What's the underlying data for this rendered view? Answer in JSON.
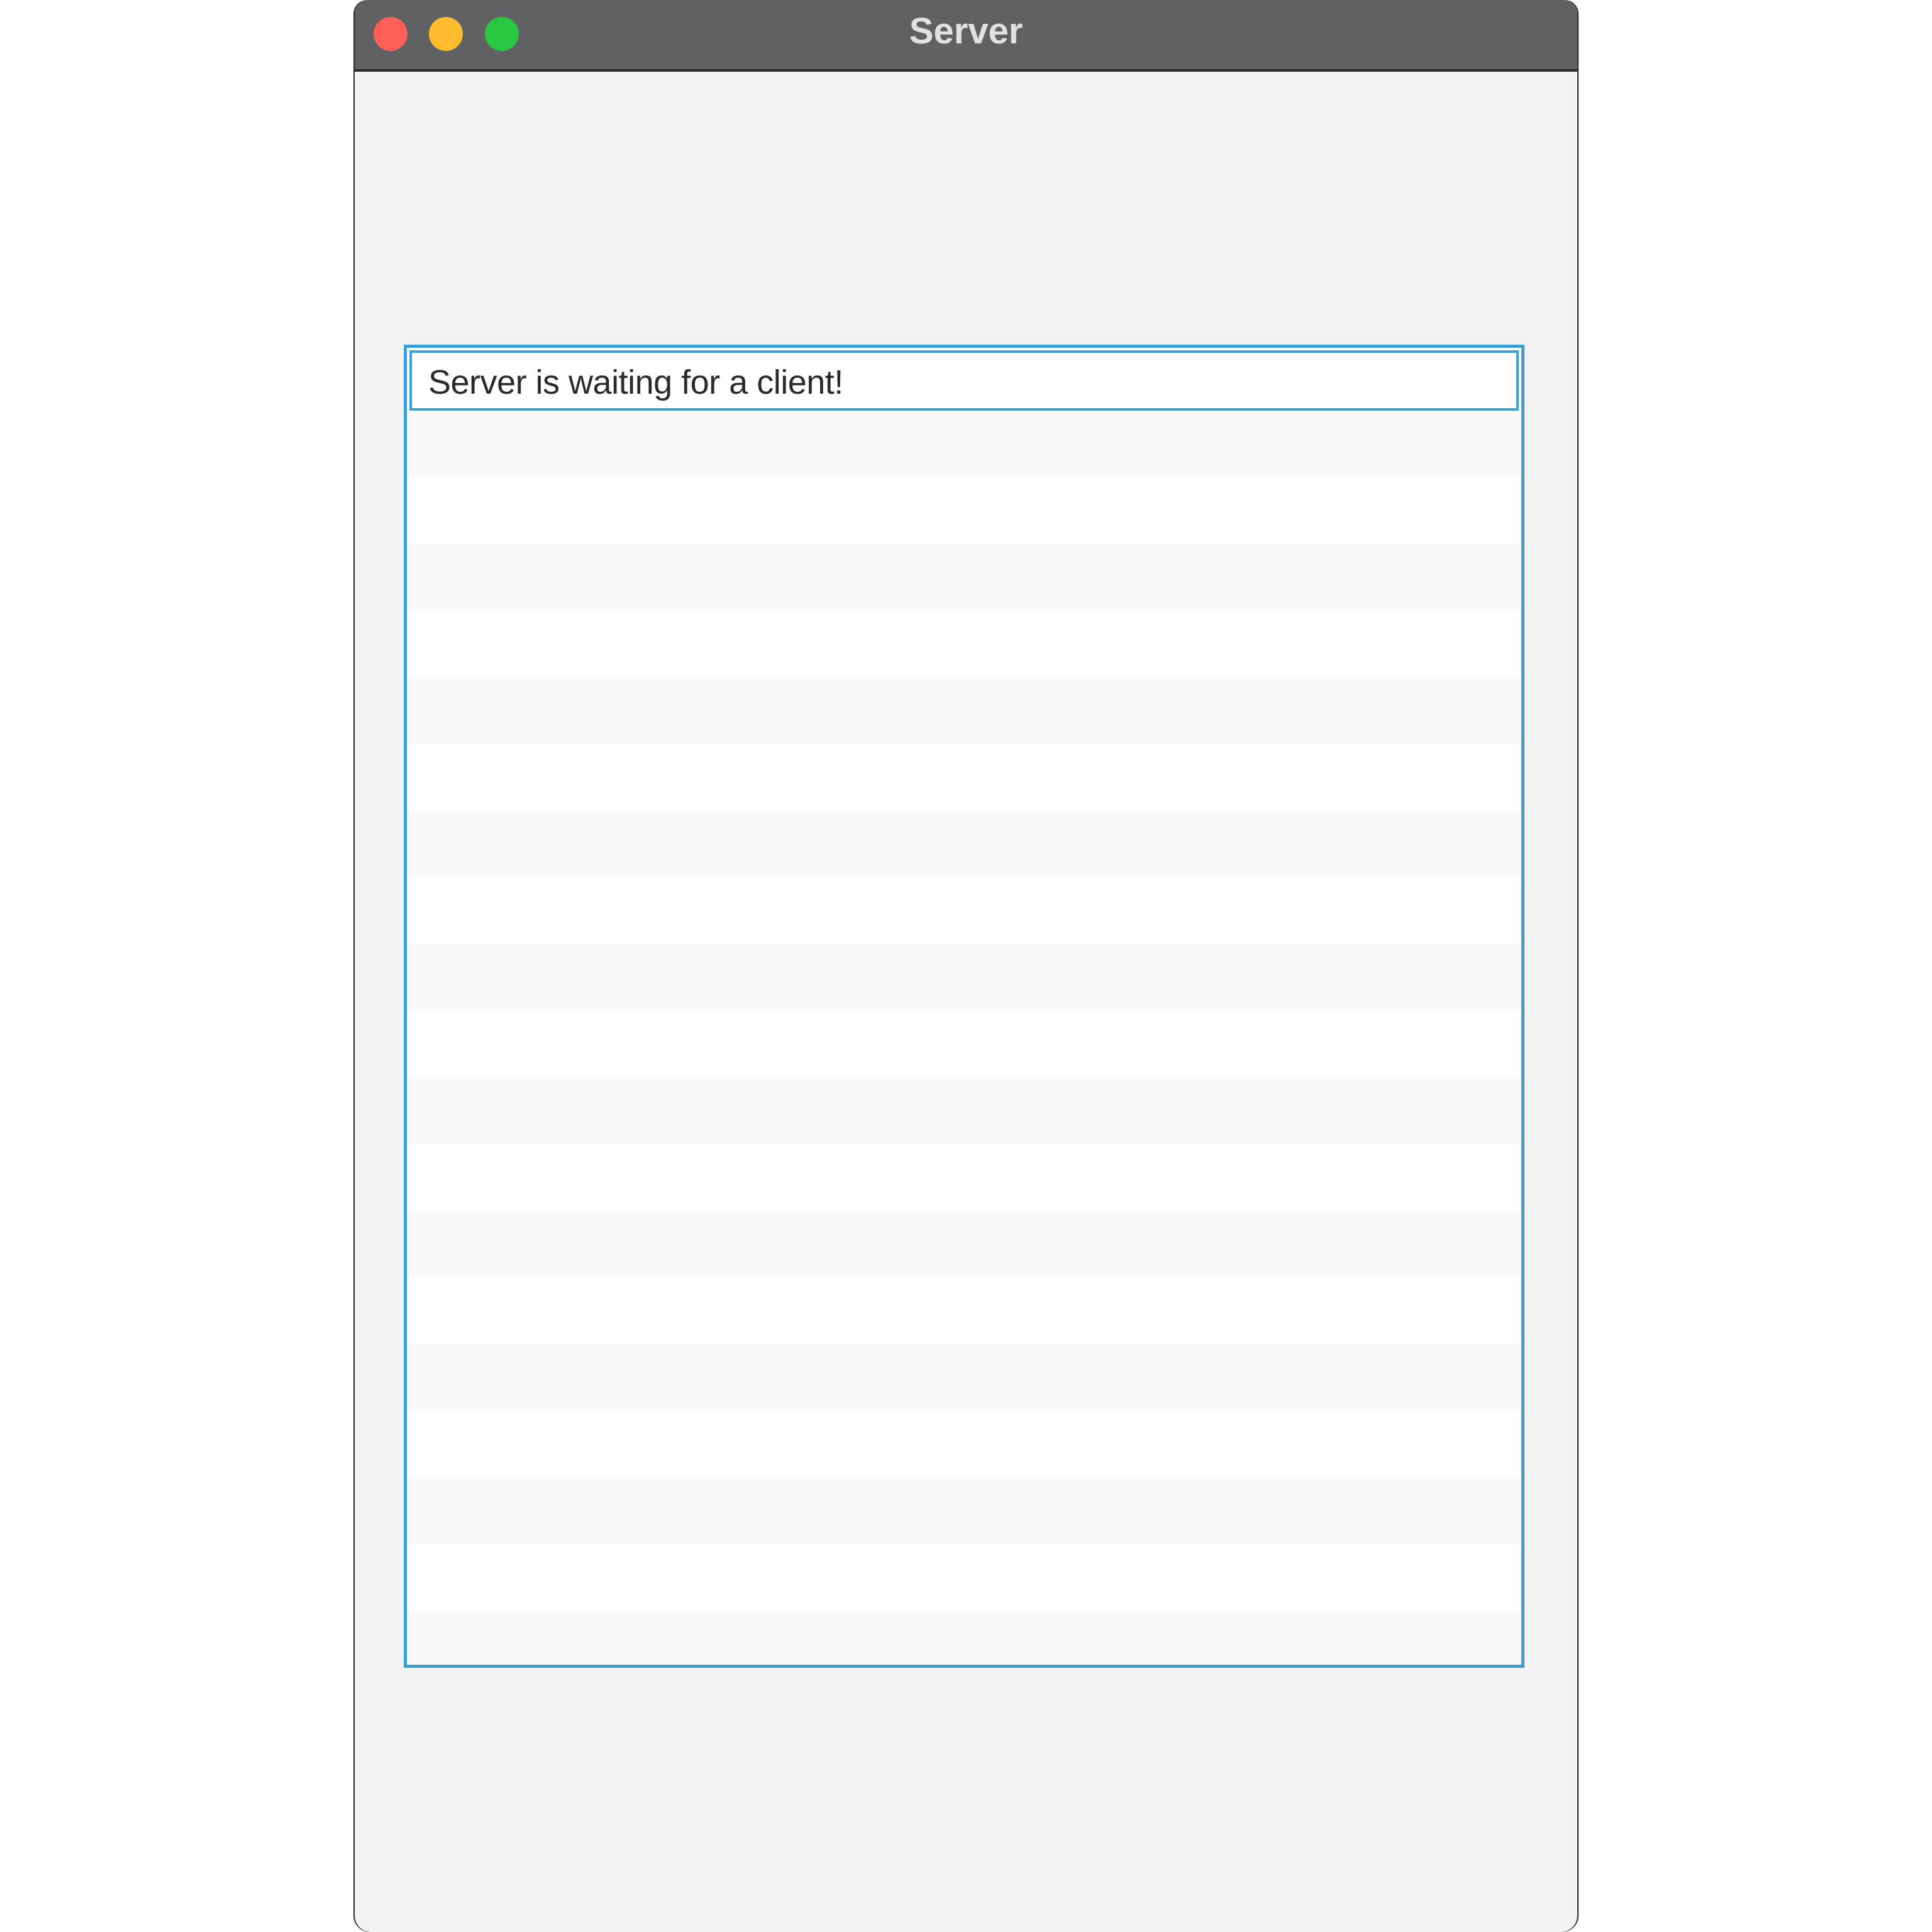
{
  "window": {
    "title": "Server"
  },
  "traffic_lights": {
    "close_color": "#fe5f57",
    "minimize_color": "#febc2e",
    "zoom_color": "#28c840"
  },
  "list": {
    "accent_color": "#3aa0d6",
    "items": [
      {
        "text": "Server is waiting for a client!"
      },
      {
        "text": ""
      },
      {
        "text": ""
      },
      {
        "text": ""
      },
      {
        "text": ""
      },
      {
        "text": ""
      },
      {
        "text": ""
      },
      {
        "text": ""
      },
      {
        "text": ""
      },
      {
        "text": ""
      },
      {
        "text": ""
      },
      {
        "text": ""
      },
      {
        "text": ""
      },
      {
        "text": ""
      },
      {
        "text": ""
      },
      {
        "text": ""
      },
      {
        "text": ""
      },
      {
        "text": ""
      },
      {
        "text": ""
      },
      {
        "text": ""
      }
    ]
  }
}
